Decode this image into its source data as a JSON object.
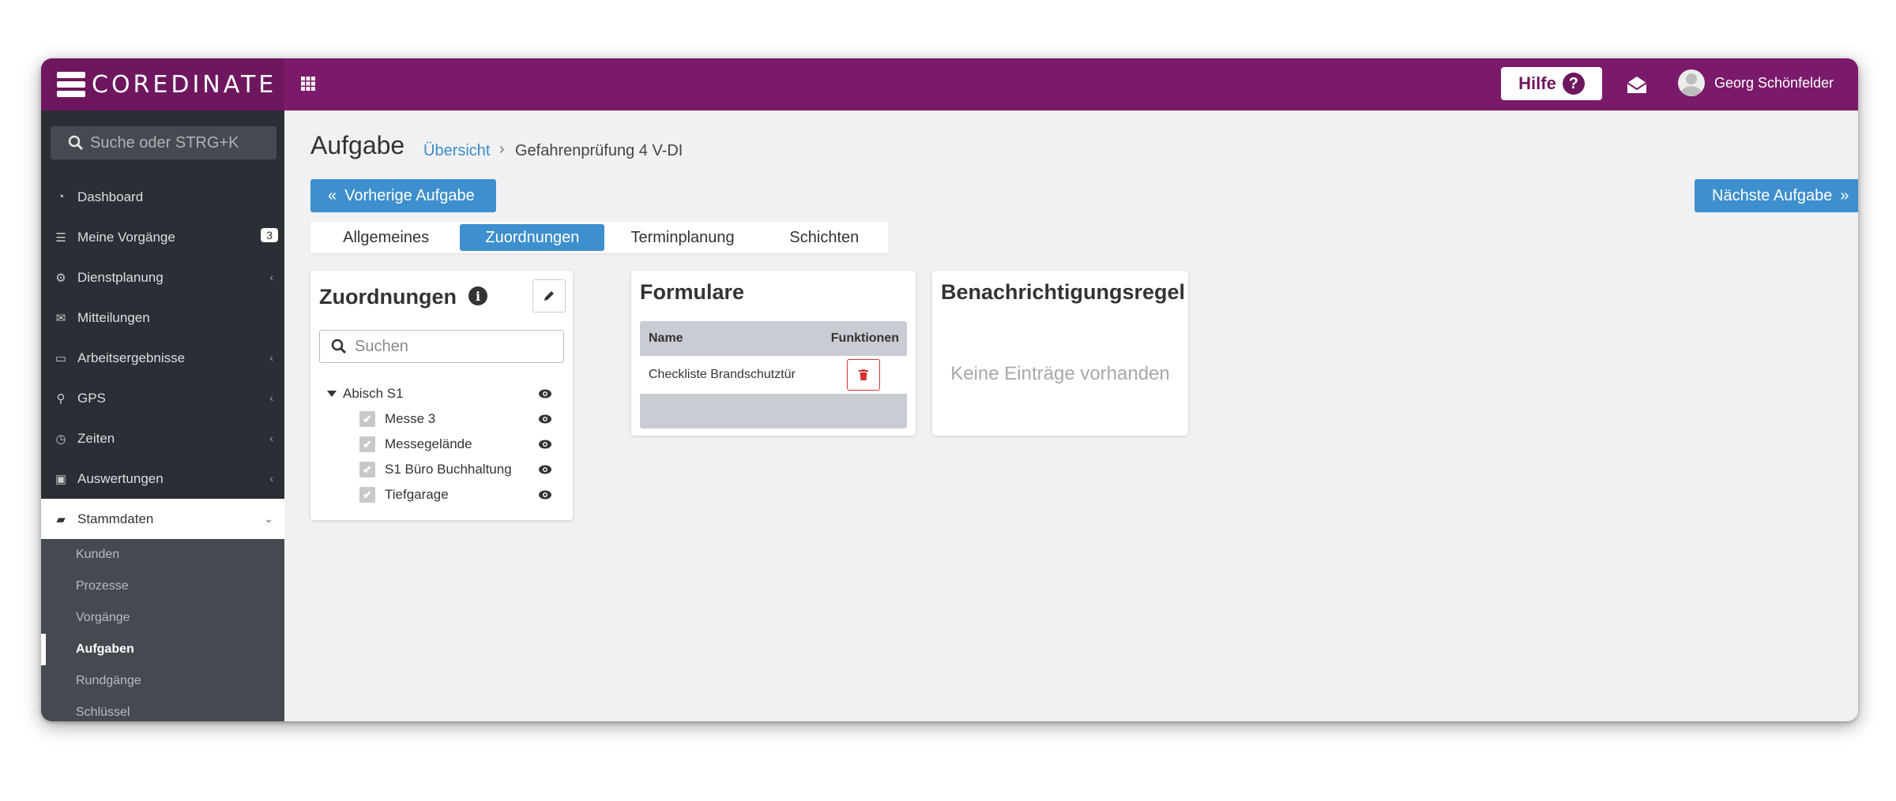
{
  "app": {
    "brand": "COREDINATE",
    "help_label": "Hilfe",
    "help_glyph": "?",
    "user_name": "Georg Schönfelder"
  },
  "sidebar": {
    "search_placeholder": "Suche oder STRG+K",
    "items": [
      {
        "label": "Dashboard",
        "icon": "dashboard-icon",
        "glyph": "◔",
        "arrow": ""
      },
      {
        "label": "Meine Vorgänge",
        "icon": "list-icon",
        "glyph": "☰",
        "badge": "3"
      },
      {
        "label": "Dienstplanung",
        "icon": "cogs-icon",
        "glyph": "⚙",
        "arrow": "‹"
      },
      {
        "label": "Mitteilungen",
        "icon": "envelope-icon",
        "glyph": "✉",
        "arrow": ""
      },
      {
        "label": "Arbeitsergebnisse",
        "icon": "monitor-icon",
        "glyph": "▭",
        "arrow": "‹"
      },
      {
        "label": "GPS",
        "icon": "map-marker-icon",
        "glyph": "⚲",
        "arrow": "‹"
      },
      {
        "label": "Zeiten",
        "icon": "clock-icon",
        "glyph": "◷",
        "arrow": "‹"
      },
      {
        "label": "Auswertungen",
        "icon": "report-icon",
        "glyph": "▣",
        "arrow": "‹"
      },
      {
        "label": "Stammdaten",
        "icon": "book-icon",
        "glyph": "▰",
        "arrow": "⌄"
      }
    ],
    "sub_items": [
      "Kunden",
      "Prozesse",
      "Vorgänge",
      "Aufgaben",
      "Rundgänge",
      "Schlüssel"
    ]
  },
  "page": {
    "title": "Aufgabe",
    "breadcrumb_link": "Übersicht",
    "breadcrumb_sep": "›",
    "breadcrumb_current": "Gefahrenprüfung 4 V-DI",
    "prev_button": "Vorherige Aufgabe",
    "prev_glyph": "«",
    "next_button": "Nächste Aufgabe",
    "next_glyph": "»",
    "tabs": [
      "Allgemeines",
      "Zuordnungen",
      "Terminplanung",
      "Schichten"
    ],
    "active_tab": "Zuordnungen"
  },
  "assignments": {
    "title": "Zuordnungen",
    "info_glyph": "i",
    "search_placeholder": "Suchen",
    "root": "Abisch S1",
    "children": [
      "Messe 3",
      "Messegelände",
      "S1 Büro Buchhaltung",
      "Tiefgarage"
    ],
    "check_glyph": "✔"
  },
  "forms": {
    "title": "Formulare",
    "col_name": "Name",
    "col_functions": "Funktionen",
    "rows": [
      "Checkliste Brandschutztür"
    ]
  },
  "notifications": {
    "title": "Benachrichtigungsregel",
    "empty": "Keine Einträge vorhanden"
  },
  "colors": {
    "topbar": "#7b1a6b",
    "sidebar": "#2a2f35",
    "accent_blue": "#3d8fcd",
    "delete_red": "#d33333"
  }
}
